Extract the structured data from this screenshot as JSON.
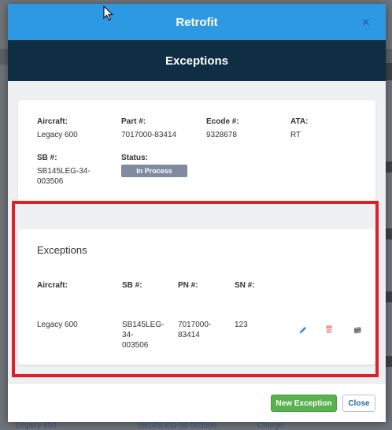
{
  "modal": {
    "title": "Retrofit",
    "close_glyph": "×",
    "subtitle": "Exceptions"
  },
  "info": {
    "aircraft_label": "Aircraft:",
    "aircraft_value": "Legacy 600",
    "part_label": "Part #:",
    "part_value": "7017000-83414",
    "ecode_label": "Ecode #:",
    "ecode_value": "9328678",
    "ata_label": "ATA:",
    "ata_value": "RT",
    "sb_label": "SB #:",
    "sb_value_line1": "SB145LEG-34-",
    "sb_value_line2": "003506",
    "status_label": "Status:",
    "status_value": "In Process",
    "status_color": "#7f8aa3"
  },
  "exceptions": {
    "title": "Exceptions",
    "columns": [
      "Aircraft:",
      "SB #:",
      "PN #:",
      "SN #:"
    ],
    "rows": [
      {
        "aircraft": "Legacy 600",
        "sb_line1": "SB145LEG-",
        "sb_line2": "34-",
        "sb_line3": "003506",
        "pn_line1": "7017000-",
        "pn_line2": "83414",
        "sn": "123",
        "actions": [
          "pencil-icon",
          "trash-icon",
          "book-icon"
        ]
      }
    ],
    "highlight_color": "#e02028"
  },
  "footer": {
    "new_exception_label": "New Exception",
    "close_label": "Close"
  },
  "background_page": {
    "row_aircraft": "Legacy 650",
    "row_sb": "SB145LEG-34-003506",
    "row_type": "Charge"
  },
  "colors": {
    "header_blue": "#2d99e3",
    "subheader_navy": "#0f2e44",
    "new_button_green": "#58b24e"
  }
}
